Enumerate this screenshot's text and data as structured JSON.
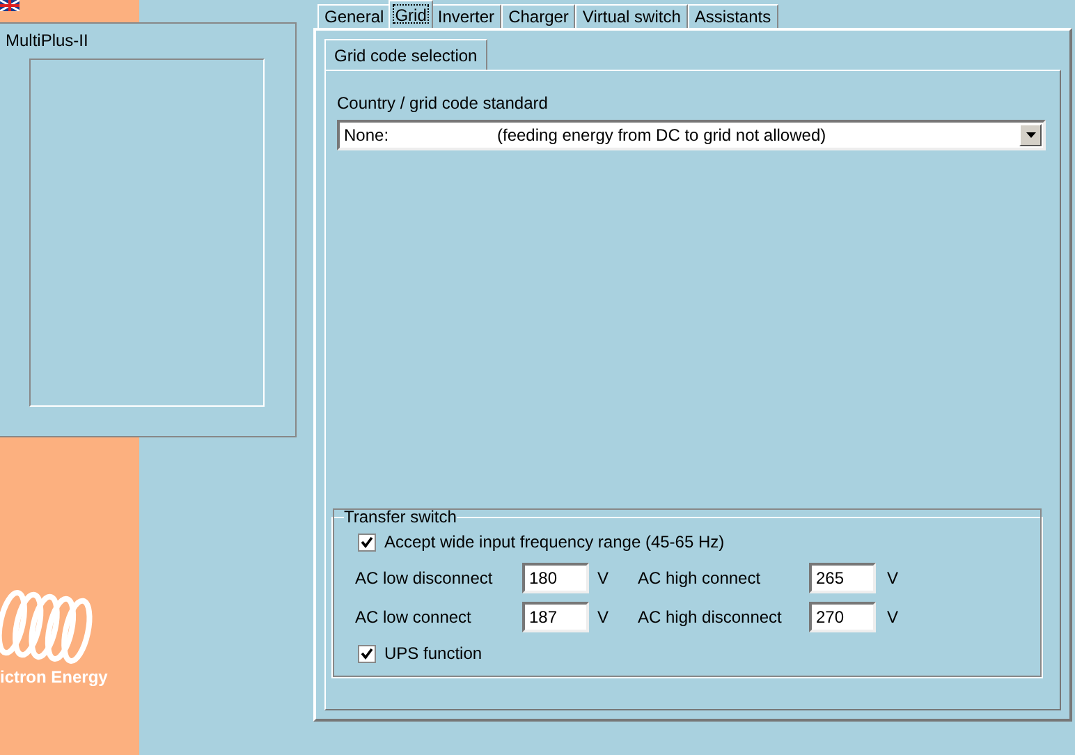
{
  "device_panel": {
    "title": "MultiPlus-II"
  },
  "tabs": [
    {
      "label": "General",
      "selected": false
    },
    {
      "label": "Grid",
      "selected": true
    },
    {
      "label": "Inverter",
      "selected": false
    },
    {
      "label": "Charger",
      "selected": false
    },
    {
      "label": "Virtual switch",
      "selected": false
    },
    {
      "label": "Assistants",
      "selected": false
    }
  ],
  "subtabs": [
    {
      "label": "Grid code selection",
      "selected": true
    }
  ],
  "grid_code": {
    "label": "Country / grid code standard",
    "value": "None:",
    "description": "(feeding energy from DC to grid not allowed)"
  },
  "transfer_switch": {
    "title": "Transfer switch",
    "wide_frequency": {
      "label": "Accept wide input frequency range (45-65 Hz)",
      "checked": true
    },
    "fields": [
      {
        "label": "AC low disconnect",
        "value": "180",
        "unit": "V"
      },
      {
        "label": "AC high connect",
        "value": "265",
        "unit": "V"
      },
      {
        "label": "AC low connect",
        "value": "187",
        "unit": "V"
      },
      {
        "label": "AC high disconnect",
        "value": "270",
        "unit": "V"
      }
    ],
    "ups": {
      "label": "UPS function",
      "checked": true
    }
  },
  "logo": {
    "text": "ictron Energy"
  }
}
